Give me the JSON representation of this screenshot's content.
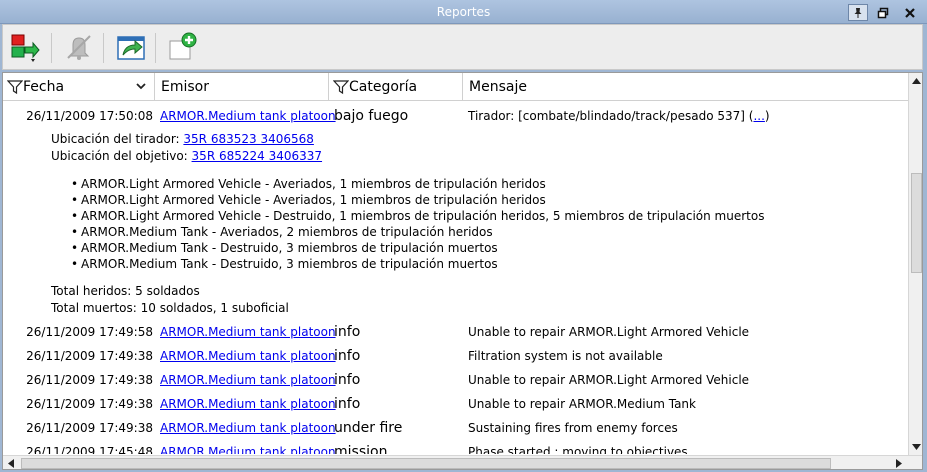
{
  "window": {
    "title": "Reportes"
  },
  "toolbar": {
    "buttons": [
      {
        "icon": "unit-report-icon"
      },
      {
        "icon": "mute-bell-icon"
      },
      {
        "icon": "export-icon"
      },
      {
        "icon": "new-report-icon"
      }
    ]
  },
  "columns": {
    "fecha": "Fecha",
    "emisor": "Emisor",
    "categoria": "Categoría",
    "mensaje": "Mensaje"
  },
  "expanded": {
    "date": "26/11/2009 17:50:08",
    "emitter": "ARMOR.Medium tank platoon",
    "category": "bajo fuego",
    "message": "Tirador: [combate/blindado/track/pesado 537] (",
    "more": "...",
    "message_end": ")",
    "shooter_label": "Ubicación del tirador: ",
    "shooter_coords": "35R 683523 3406568",
    "target_label": "Ubicación del objetivo: ",
    "target_coords": "35R 685224 3406337",
    "bullets": [
      "ARMOR.Light Armored Vehicle - Averiados, 1 miembros de tripulación heridos",
      "ARMOR.Light Armored Vehicle - Averiados, 1 miembros de tripulación heridos",
      "ARMOR.Light Armored Vehicle - Destruido, 1 miembros de tripulación heridos, 5 miembros de tripulación muertos",
      "ARMOR.Medium Tank - Averiados, 2 miembros de tripulación heridos",
      "ARMOR.Medium Tank - Destruido, 3 miembros de tripulación muertos",
      "ARMOR.Medium Tank - Destruido, 3 miembros de tripulación muertos"
    ],
    "total_wounded": "Total heridos: 5 soldados",
    "total_dead": "Total muertos: 10 soldados, 1 suboficial"
  },
  "rows": [
    {
      "date": "26/11/2009 17:49:58",
      "emitter": "ARMOR.Medium tank platoon",
      "category": "info",
      "message": "Unable to repair ARMOR.Light Armored Vehicle"
    },
    {
      "date": "26/11/2009 17:49:38",
      "emitter": "ARMOR.Medium tank platoon",
      "category": "info",
      "message": "Filtration system is not available"
    },
    {
      "date": "26/11/2009 17:49:38",
      "emitter": "ARMOR.Medium tank platoon",
      "category": "info",
      "message": "Unable to repair ARMOR.Light Armored Vehicle"
    },
    {
      "date": "26/11/2009 17:49:38",
      "emitter": "ARMOR.Medium tank platoon",
      "category": "info",
      "message": "Unable to repair ARMOR.Medium Tank"
    },
    {
      "date": "26/11/2009 17:49:38",
      "emitter": "ARMOR.Medium tank platoon",
      "category": "under fire",
      "message": "Sustaining fires from enemy forces"
    },
    {
      "date": "26/11/2009 17:45:48",
      "emitter": "ARMOR.Medium tank platoon",
      "category": "mission",
      "message": "Phase started : moving to objectives"
    }
  ]
}
